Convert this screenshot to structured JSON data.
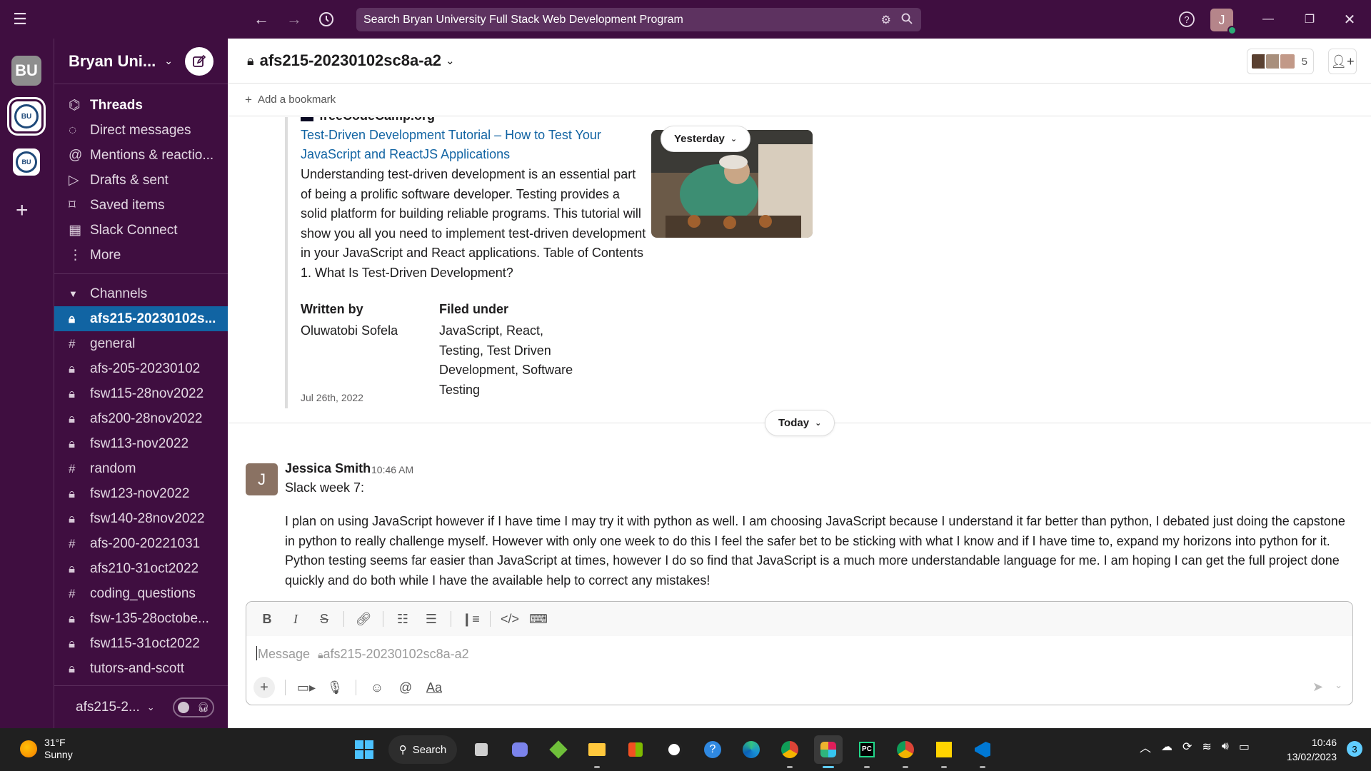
{
  "topbar": {
    "search_text": "Search Bryan University Full Stack Web Development Program",
    "user_initial": "J"
  },
  "rail": {
    "workspace_initials": "BU",
    "logo_text": "BU"
  },
  "sidebar": {
    "workspace_name": "Bryan Uni...",
    "nav": [
      {
        "label": "Threads",
        "icon": "threads-icon"
      },
      {
        "label": "Direct messages",
        "icon": "dm-icon"
      },
      {
        "label": "Mentions & reactio...",
        "icon": "at-icon"
      },
      {
        "label": "Drafts & sent",
        "icon": "send-icon"
      },
      {
        "label": "Saved items",
        "icon": "bookmark-icon"
      },
      {
        "label": "Slack Connect",
        "icon": "building-icon"
      },
      {
        "label": "More",
        "icon": "more-icon"
      }
    ],
    "channels_header": "Channels",
    "channels": [
      {
        "name": "afs215-20230102s...",
        "type": "private"
      },
      {
        "name": "general",
        "type": "public"
      },
      {
        "name": "afs-205-20230102",
        "type": "private"
      },
      {
        "name": "fsw115-28nov2022",
        "type": "private"
      },
      {
        "name": "afs200-28nov2022",
        "type": "private"
      },
      {
        "name": "fsw113-nov2022",
        "type": "private"
      },
      {
        "name": "random",
        "type": "public"
      },
      {
        "name": "fsw123-nov2022",
        "type": "private"
      },
      {
        "name": "fsw140-28nov2022",
        "type": "private"
      },
      {
        "name": "afs-200-20221031",
        "type": "public"
      },
      {
        "name": "afs210-31oct2022",
        "type": "private"
      },
      {
        "name": "coding_questions",
        "type": "public"
      },
      {
        "name": "fsw-135-28octobe...",
        "type": "private"
      },
      {
        "name": "fsw115-31oct2022",
        "type": "private"
      },
      {
        "name": "tutors-and-scott",
        "type": "private"
      }
    ],
    "footer_channel": "afs215-2..."
  },
  "channel": {
    "title": "afs215-20230102sc8a-a2",
    "member_count": "5",
    "bookmark_label": "Add a bookmark"
  },
  "unfurl": {
    "site": "freeCodeCamp.org",
    "title": "Test-Driven Development Tutorial – How to Test Your JavaScript and ReactJS Applications",
    "description": "Understanding test-driven development is an essential part of being a prolific software developer. Testing provides a solid platform for building reliable programs. This tutorial will show you all you need to implement test-driven development in your JavaScript and React applications. Table of Contents 1. What Is Test-Driven Development?",
    "written_by_label": "Written by",
    "author": "Oluwatobi Sofela",
    "filed_under_label": "Filed under",
    "tags": "JavaScript, React, Testing, Test Driven Development, Software Testing",
    "date": "Jul 26th, 2022"
  },
  "dividers": {
    "yesterday": "Yesterday",
    "today": "Today"
  },
  "message": {
    "author": "Jessica Smith",
    "avatar_initial": "J",
    "time": "10:46 AM",
    "line1": "Slack week 7:",
    "body": "I plan on using JavaScript however if I have time I may try it with python as well. I am choosing JavaScript because I understand it far better than python, I debated just doing the capstone in python to really challenge myself. However with only one week to do this I feel the safer bet to be sticking with what I know and if I have time to, expand my horizons into python for it. Python testing seems far easier than JavaScript at times, however I do so find that JavaScript is a much more understandable language for me. I am hoping I can get the full project done quickly and do both while I have the available help to correct any mistakes!"
  },
  "composer": {
    "placeholder": "Message",
    "channel": "afs215-20230102sc8a-a2",
    "format_label": "Aa"
  },
  "taskbar": {
    "temp": "31°F",
    "condition": "Sunny",
    "search_label": "Search",
    "time": "10:46",
    "date": "13/02/2023",
    "notifications": "3"
  },
  "colors": {
    "aubergine": "#3f0e40",
    "active_channel": "#1164a3",
    "link": "#1264a3"
  }
}
